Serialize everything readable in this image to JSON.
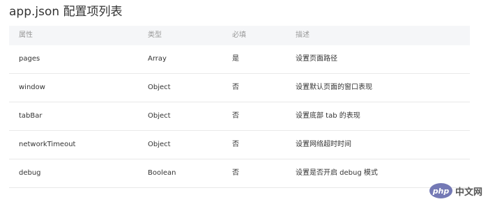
{
  "page": {
    "title": "app.json 配置项列表"
  },
  "table": {
    "headers": [
      "属性",
      "类型",
      "必填",
      "描述"
    ],
    "rows": [
      {
        "attr": "pages",
        "type": "Array",
        "required": "是",
        "desc": "设置页面路径"
      },
      {
        "attr": "window",
        "type": "Object",
        "required": "否",
        "desc": "设置默认页面的窗口表现"
      },
      {
        "attr": "tabBar",
        "type": "Object",
        "required": "否",
        "desc": "设置底部 tab 的表现"
      },
      {
        "attr": "networkTimeout",
        "type": "Object",
        "required": "否",
        "desc": "设置网络超时时间"
      },
      {
        "attr": "debug",
        "type": "Boolean",
        "required": "否",
        "desc": "设置是否开启 debug 模式"
      }
    ]
  },
  "logo": {
    "badge": "php",
    "text": "中文网",
    "colors": {
      "badge_bg": "#7479b5"
    }
  },
  "colors": {
    "link": "#3e80c4",
    "header_bg": "#f5f6f8",
    "divider": "#e9e9e9"
  }
}
